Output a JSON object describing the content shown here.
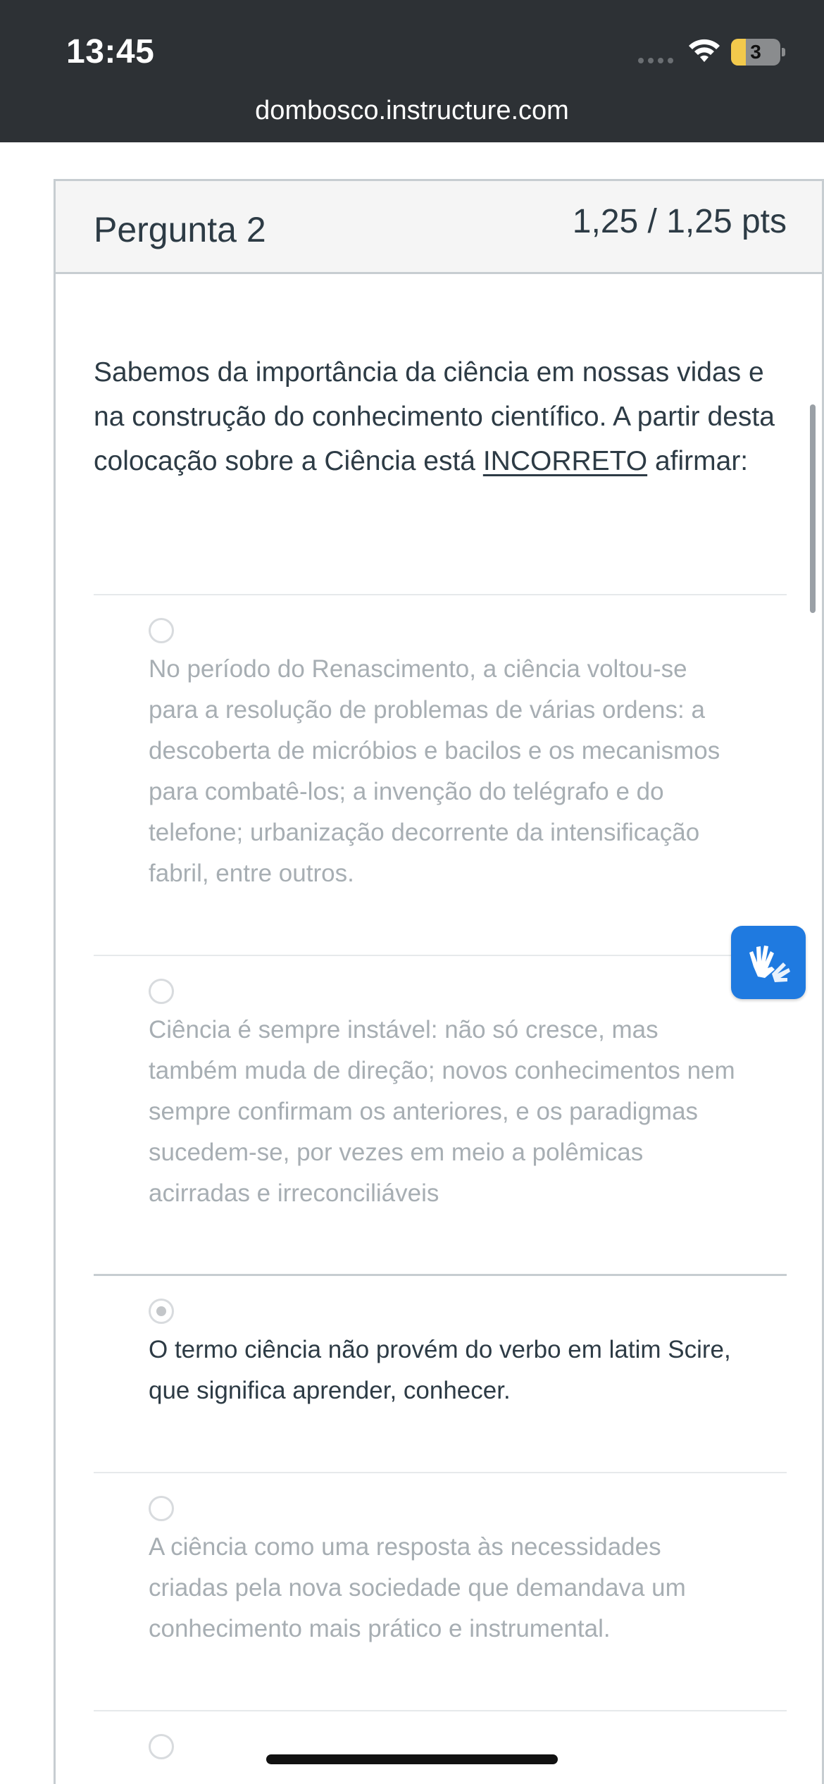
{
  "status_bar": {
    "time": "13:45",
    "battery_level": "3",
    "battery_fraction": 0.3,
    "accent": "#f2c94c"
  },
  "browser": {
    "url": "dombosco.instructure.com"
  },
  "question": {
    "title": "Pergunta 2",
    "points": "1,25 / 1,25 pts",
    "text_before": "Sabemos da importância da ciência em nossas vidas e na construção do conhecimento científico. A partir desta colocação sobre a Ciência está ",
    "text_emph": "INCORRETO",
    "text_after": " afirmar:"
  },
  "options": [
    {
      "text": "No período do Renascimento, a ciência voltou-se para a resolução de problemas de várias ordens: a descoberta de micróbios e bacilos e os mecanismos para combatê-los; a invenção do telégrafo e do telefone; urbanização decorrente da intensificação fabril, entre outros.",
      "selected": false
    },
    {
      "text": "Ciência é sempre instável: não só cresce, mas também muda de direção; novos conhecimentos nem sempre confirmam os anteriores, e os paradigmas sucedem-se, por vezes em meio a polêmicas acirradas e irreconciliáveis",
      "selected": false
    },
    {
      "text": "O termo ciência não provém do verbo em latim Scire, que significa aprender, conhecer.",
      "selected": true
    },
    {
      "text": "A ciência como uma resposta às necessidades criadas pela nova sociedade que demandava um conhecimento mais prático e instrumental.",
      "selected": false
    },
    {
      "text": "",
      "selected": false
    }
  ],
  "icons": {
    "accessibility": "sign-language-hands-icon",
    "wifi": "wifi-icon",
    "battery": "battery-icon",
    "signal": "cellular-signal-icon"
  },
  "colors": {
    "header_bar": "#2d3135",
    "accessibility_button": "#1f7ae0",
    "text_primary": "#2d3b45",
    "text_muted": "#a7aeb3"
  }
}
